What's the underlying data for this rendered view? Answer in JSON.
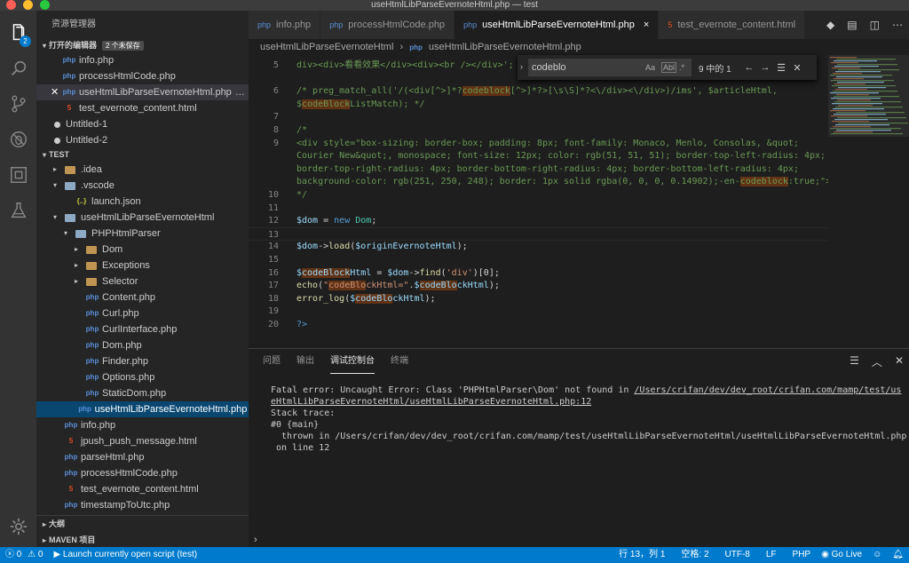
{
  "window": {
    "title": "useHtmlLibParseEvernoteHtml.php — test"
  },
  "sidebar": {
    "title": "资源管理器",
    "open_editors": {
      "label": "打开的编辑器",
      "badge": "2 个未保存",
      "items": [
        {
          "name": "info.php",
          "type": "php"
        },
        {
          "name": "processHtmlCode.php",
          "type": "php"
        },
        {
          "name": "useHtmlLibParseEvernoteHtml.php",
          "type": "php",
          "extra": "…",
          "active": true
        },
        {
          "name": "test_evernote_content.html",
          "type": "html"
        },
        {
          "name": "Untitled-1",
          "type": "dirty"
        },
        {
          "name": "Untitled-2",
          "type": "dirty"
        }
      ]
    },
    "test": {
      "label": "TEST",
      "items": [
        {
          "name": ".idea",
          "type": "folder",
          "depth": 0,
          "arrow": "▸"
        },
        {
          "name": ".vscode",
          "type": "folder-open",
          "depth": 0,
          "arrow": "▾"
        },
        {
          "name": "launch.json",
          "type": "json",
          "depth": 1,
          "arrow": ""
        },
        {
          "name": "useHtmlLibParseEvernoteHtml",
          "type": "folder-open",
          "depth": 0,
          "arrow": "▾"
        },
        {
          "name": "PHPHtmlParser",
          "type": "folder-open",
          "depth": 1,
          "arrow": "▾"
        },
        {
          "name": "Dom",
          "type": "folder",
          "depth": 2,
          "arrow": "▸"
        },
        {
          "name": "Exceptions",
          "type": "folder",
          "depth": 2,
          "arrow": "▸"
        },
        {
          "name": "Selector",
          "type": "folder",
          "depth": 2,
          "arrow": "▸"
        },
        {
          "name": "Content.php",
          "type": "php",
          "depth": 2,
          "arrow": ""
        },
        {
          "name": "Curl.php",
          "type": "php",
          "depth": 2,
          "arrow": ""
        },
        {
          "name": "CurlInterface.php",
          "type": "php",
          "depth": 2,
          "arrow": ""
        },
        {
          "name": "Dom.php",
          "type": "php",
          "depth": 2,
          "arrow": ""
        },
        {
          "name": "Finder.php",
          "type": "php",
          "depth": 2,
          "arrow": ""
        },
        {
          "name": "Options.php",
          "type": "php",
          "depth": 2,
          "arrow": ""
        },
        {
          "name": "StaticDom.php",
          "type": "php",
          "depth": 2,
          "arrow": ""
        },
        {
          "name": "useHtmlLibParseEvernoteHtml.php",
          "type": "php",
          "depth": 1.3,
          "arrow": "",
          "selected": true
        },
        {
          "name": "info.php",
          "type": "php",
          "depth": 0,
          "arrow": ""
        },
        {
          "name": "jpush_push_message.html",
          "type": "html",
          "depth": 0,
          "arrow": ""
        },
        {
          "name": "parseHtml.php",
          "type": "php",
          "depth": 0,
          "arrow": ""
        },
        {
          "name": "processHtmlCode.php",
          "type": "php",
          "depth": 0,
          "arrow": ""
        },
        {
          "name": "test_evernote_content.html",
          "type": "html",
          "depth": 0,
          "arrow": ""
        },
        {
          "name": "timestampToUtc.php",
          "type": "php",
          "depth": 0,
          "arrow": ""
        }
      ]
    },
    "outline": {
      "label": "大纲"
    },
    "maven": {
      "label": "MAVEN 项目"
    }
  },
  "tabs": [
    {
      "label": "info.php",
      "type": "php"
    },
    {
      "label": "processHtmlCode.php",
      "type": "php"
    },
    {
      "label": "useHtmlLibParseEvernoteHtml.php",
      "type": "php",
      "active": true,
      "close": "×"
    },
    {
      "label": "test_evernote_content.html",
      "type": "html"
    }
  ],
  "breadcrumb": {
    "folder": "useHtmlLibParseEvernoteHtml",
    "sep": "›",
    "file": "useHtmlLibParseEvernoteHtml.php"
  },
  "find": {
    "query": "codeblo",
    "count": "9 中的 1",
    "opt_case": "Aa",
    "opt_word": "Abl",
    "opt_regex": ".*"
  },
  "editor": {
    "lines": [
      {
        "n": "5",
        "parts": [
          [
            "c-comment",
            "div><div>看看效果</div><div><br /></div>';"
          ]
        ]
      },
      {
        "n": "",
        "parts": []
      },
      {
        "n": "6",
        "parts": [
          [
            "c-comment",
            "/* preg_match_all('/(<div[^>]*?"
          ],
          [
            "c-comment hl",
            "codeblock"
          ],
          [
            "c-comment",
            "[^>]*?>[\\s\\S]*?<\\/div><\\/div>)/ims', $articleHtml,"
          ]
        ]
      },
      {
        "n": "",
        "parts": [
          [
            "c-comment",
            "$"
          ],
          [
            "c-comment hl",
            "codeBlock"
          ],
          [
            "c-comment",
            "ListMatch); */"
          ]
        ]
      },
      {
        "n": "7",
        "parts": []
      },
      {
        "n": "8",
        "parts": [
          [
            "c-comment",
            "/*"
          ]
        ]
      },
      {
        "n": "9",
        "parts": [
          [
            "c-comment",
            "<div style=\"box-sizing: border-box; padding: 8px; font-family: Monaco, Menlo, Consolas, &quot;"
          ]
        ]
      },
      {
        "n": "",
        "parts": [
          [
            "c-comment",
            "Courier New&quot;, monospace; font-size: 12px; color: rgb(51, 51, 51); border-top-left-radius: 4px;"
          ]
        ]
      },
      {
        "n": "",
        "parts": [
          [
            "c-comment",
            "border-top-right-radius: 4px; border-bottom-right-radius: 4px; border-bottom-left-radius: 4px;"
          ]
        ]
      },
      {
        "n": "",
        "parts": [
          [
            "c-comment",
            "background-color: rgb(251, 250, 248); border: 1px solid rgba(0, 0, 0, 0.14902);-en-"
          ],
          [
            "c-comment hl",
            "codeblock"
          ],
          [
            "c-comment",
            ":true;\">"
          ]
        ]
      },
      {
        "n": "10",
        "parts": [
          [
            "c-comment",
            "*/"
          ]
        ]
      },
      {
        "n": "11",
        "parts": []
      },
      {
        "n": "12",
        "parts": [
          [
            "c-var",
            "$dom"
          ],
          [
            "c-pl",
            " = "
          ],
          [
            "c-kw",
            "new"
          ],
          [
            "c-pl",
            " "
          ],
          [
            "c-cls",
            "Dom"
          ],
          [
            "c-pl",
            ";"
          ]
        ]
      },
      {
        "n": "13",
        "parts": [],
        "current": true
      },
      {
        "n": "14",
        "parts": [
          [
            "c-var",
            "$dom"
          ],
          [
            "c-pl",
            "->"
          ],
          [
            "c-fn",
            "load"
          ],
          [
            "c-pl",
            "("
          ],
          [
            "c-var",
            "$originEvernoteHtml"
          ],
          [
            "c-pl",
            ");"
          ]
        ]
      },
      {
        "n": "15",
        "parts": []
      },
      {
        "n": "16",
        "parts": [
          [
            "c-var",
            "$"
          ],
          [
            "c-var hl",
            "codeBlock"
          ],
          [
            "c-var",
            "Html"
          ],
          [
            "c-pl",
            " = "
          ],
          [
            "c-var",
            "$dom"
          ],
          [
            "c-pl",
            "->"
          ],
          [
            "c-fn",
            "find"
          ],
          [
            "c-pl",
            "("
          ],
          [
            "c-str",
            "'div'"
          ],
          [
            "c-pl",
            ")["
          ],
          [
            "c-pl",
            "0"
          ],
          [
            "c-pl",
            "];"
          ]
        ]
      },
      {
        "n": "17",
        "parts": [
          [
            "c-fn",
            "echo"
          ],
          [
            "c-pl",
            "("
          ],
          [
            "c-str",
            "\""
          ],
          [
            "c-str hl",
            "codeBlo"
          ],
          [
            "c-str",
            "ckHtml=\""
          ],
          [
            "c-pl",
            "."
          ],
          [
            "c-var",
            "$"
          ],
          [
            "c-var hl",
            "codeBlo"
          ],
          [
            "c-var",
            "ckHtml"
          ],
          [
            "c-pl",
            ");"
          ]
        ]
      },
      {
        "n": "18",
        "parts": [
          [
            "c-fn",
            "error_log"
          ],
          [
            "c-pl",
            "("
          ],
          [
            "c-var",
            "$"
          ],
          [
            "c-var hl",
            "codeBlo"
          ],
          [
            "c-var",
            "ckHtml"
          ],
          [
            "c-pl",
            ");"
          ]
        ]
      },
      {
        "n": "19",
        "parts": []
      },
      {
        "n": "20",
        "parts": [
          [
            "c-kw",
            "?>"
          ]
        ]
      }
    ]
  },
  "panel": {
    "tabs": [
      {
        "label": "问题"
      },
      {
        "label": "输出"
      },
      {
        "label": "调试控制台",
        "active": true
      },
      {
        "label": "终端"
      }
    ],
    "console": {
      "error_prefix": "Fatal error: Uncaught Error: Class 'PHPHtmlParser\\Dom' not found in ",
      "error_path": "/Users/crifan/dev/dev_root/crifan.com/mamp/test/useHtmlLibParseEvernoteHtml/useHtmlLibParseEvernoteHtml.php:12",
      "stack": "Stack trace:",
      "frame0": "#0 {main}",
      "thrown": "  thrown in /Users/crifan/dev/dev_root/crifan.com/mamp/test/useHtmlLibParseEvernoteHtml/useHtmlLibParseEvernoteHtml.php",
      "online": " on line 12"
    },
    "prompt": "›"
  },
  "statusbar": {
    "errors": "0",
    "warnings": "0",
    "launch": "Launch currently open script (test)",
    "position": "行 13，列 1",
    "spaces": "空格: 2",
    "encoding": "UTF-8",
    "eol": "LF",
    "language": "PHP",
    "golive": "Go Live"
  },
  "colors": {
    "accent": "#007acc",
    "selection": "#094771",
    "find_highlight": "#613214"
  }
}
